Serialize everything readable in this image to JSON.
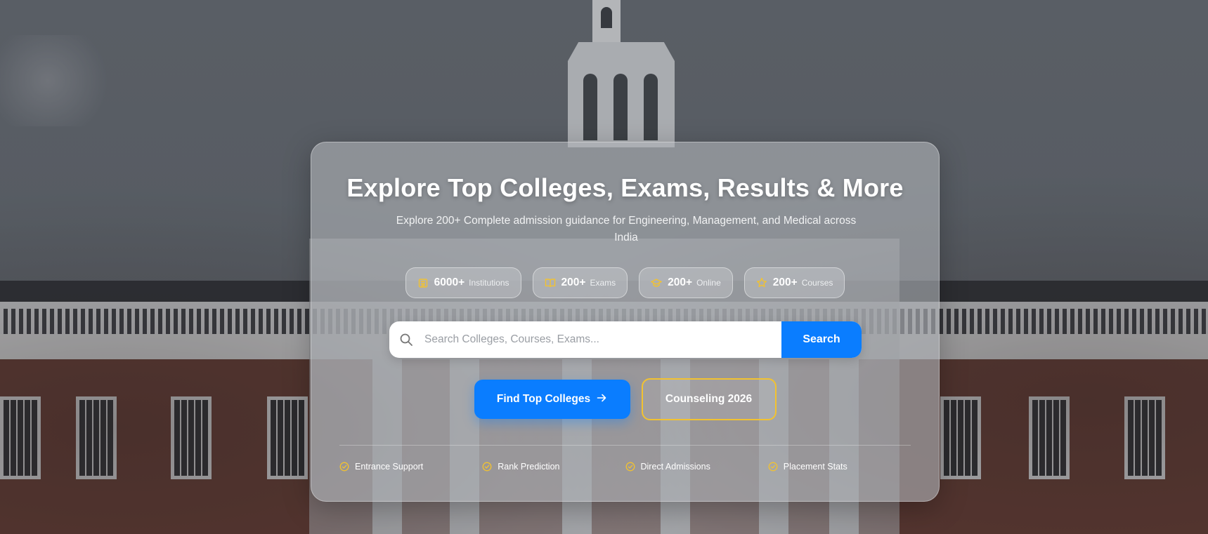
{
  "hero": {
    "title": "Explore Top Colleges, Exams, Results & More",
    "subtitle": "Explore 200+ Complete admission guidance for Engineering, Management, and Medical across India"
  },
  "stats": [
    {
      "icon": "building-icon",
      "value": "6000+",
      "label": "Institutions"
    },
    {
      "icon": "book-icon",
      "value": "200+",
      "label": "Exams"
    },
    {
      "icon": "graduation-cap-icon",
      "value": "200+",
      "label": "Online"
    },
    {
      "icon": "star-icon",
      "value": "200+",
      "label": "Courses"
    }
  ],
  "search": {
    "placeholder": "Search Colleges, Courses, Exams...",
    "value": "",
    "button_label": "Search"
  },
  "actions": {
    "primary_label": "Find Top Colleges",
    "secondary_label": "Counseling 2026"
  },
  "features": [
    "Entrance Support",
    "Rank Prediction",
    "Direct Admissions",
    "Placement Stats"
  ],
  "colors": {
    "accent_blue": "#0a7dff",
    "accent_gold": "#f2c230"
  }
}
